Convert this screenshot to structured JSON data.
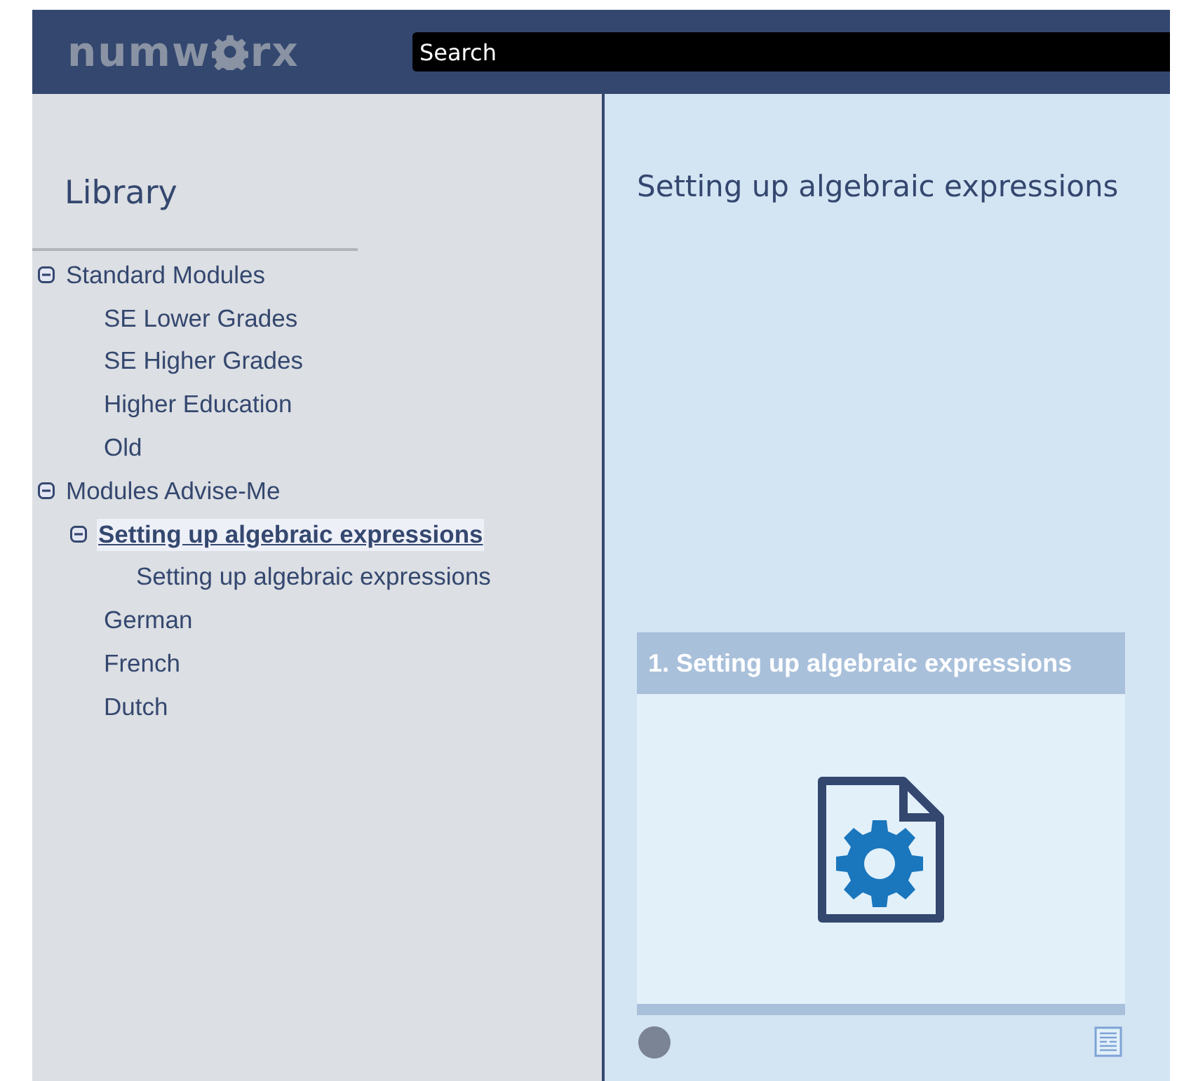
{
  "header": {
    "logo": {
      "before": "numw",
      "after": "rx"
    },
    "search": {
      "placeholder": "Search"
    }
  },
  "sidebar": {
    "title": "Library",
    "tree": [
      {
        "label": "Standard Modules",
        "expanded": true,
        "selected": false,
        "children": [
          {
            "label": "SE Lower Grades",
            "selected": false
          },
          {
            "label": "SE Higher Grades",
            "selected": false
          },
          {
            "label": "Higher Education",
            "selected": false
          },
          {
            "label": "Old",
            "selected": false
          }
        ]
      },
      {
        "label": "Modules Advise-Me",
        "expanded": true,
        "selected": false,
        "children": [
          {
            "label": "Setting up algebraic expressions",
            "expanded": true,
            "selected": true,
            "children": [
              {
                "label": "Setting up algebraic expressions",
                "selected": false
              }
            ]
          },
          {
            "label": "German",
            "selected": false
          },
          {
            "label": "French",
            "selected": false
          },
          {
            "label": "Dutch",
            "selected": false
          }
        ]
      }
    ]
  },
  "main": {
    "title": "Setting up algebraic expressions",
    "card": {
      "title": "1. Setting up algebraic expressions"
    }
  }
}
